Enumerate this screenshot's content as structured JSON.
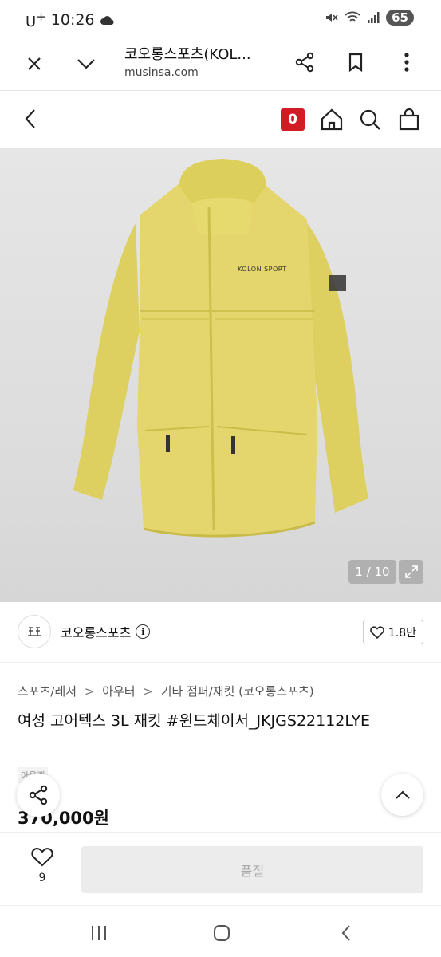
{
  "status": {
    "carrier": "U",
    "carrier_sup": "+",
    "time": "10:26",
    "battery": "65"
  },
  "browser": {
    "title": "코오롱스포츠(KOL...",
    "url": "musinsa.com"
  },
  "header": {
    "cart_count": "0"
  },
  "gallery": {
    "counter": "1 / 10",
    "chest_logo": "KOLON SPORT"
  },
  "brand": {
    "name": "코오롱스포츠",
    "likes": "1.8만"
  },
  "product": {
    "breadcrumb": [
      "스포츠/레저",
      "아우터",
      "기타 점퍼/재킷 (코오롱스포츠)"
    ],
    "breadcrumb_sep": ">",
    "title": "여성 고어텍스 3L 재킷 #윈드체이서_JKJGS22112LYE",
    "discount_label": "아울렛",
    "price": "370,000원"
  },
  "cta": {
    "wish_count": "9",
    "button_label": "품절"
  },
  "colors": {
    "cart_badge": "#d11b25",
    "jacket": "#e2d46a",
    "soldout_bg": "#ececec"
  }
}
